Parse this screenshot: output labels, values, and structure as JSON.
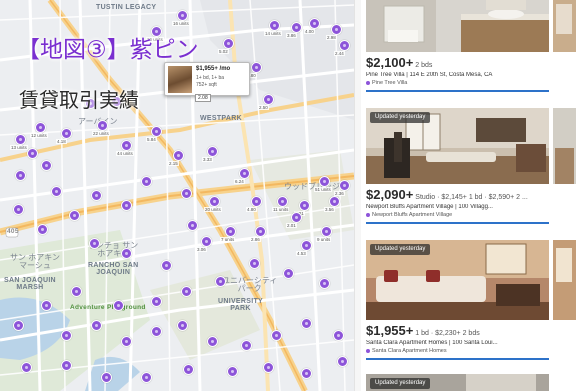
{
  "overlay": {
    "title": "【地図③】紫ピン",
    "subtitle": "賃貸取引実績"
  },
  "map": {
    "places": [
      {
        "key": "tustin_legacy",
        "label": "TUSTIN LEGACY",
        "cls": ""
      },
      {
        "key": "westpark",
        "label": "WESTPARK",
        "cls": ""
      },
      {
        "key": "rancho_san_joaquin",
        "label": "RANCHO SAN\nJOAQUIN",
        "cls": ""
      },
      {
        "key": "san_joaquin_marsh",
        "label": "SAN JOAQUIN\nMARSH",
        "cls": ""
      },
      {
        "key": "university_park",
        "label": "UNIVERSITY\nPARK",
        "cls": ""
      },
      {
        "key": "adventure_playground",
        "label": "Adventure Playground",
        "cls": "green"
      },
      {
        "key": "jp_irvine",
        "label": "アーバイン",
        "cls": "jp"
      },
      {
        "key": "jp_rancho",
        "label": "ランチョ サン\nホアキン",
        "cls": "jp"
      },
      {
        "key": "jp_university",
        "label": "ユニバーシティ\nパーク",
        "cls": "jp"
      },
      {
        "key": "jp_marsh",
        "label": "サン ホアキン\nマーシュ",
        "cls": "jp"
      },
      {
        "key": "jp_woodbridge",
        "label": "ウッドブリッジ",
        "cls": "jp"
      },
      {
        "key": "route_405",
        "label": "405",
        "cls": "road"
      }
    ],
    "pin_labels": [
      "14 units",
      "3.86",
      "4.00",
      "2.98",
      "16 units",
      "5.02",
      "2.44",
      "36 units",
      "1.80",
      "2.50",
      "12 units",
      "13 units",
      "4.18",
      "22 units",
      "44 units",
      "5.84",
      "2.15",
      "3.33",
      "6.24",
      "20 units",
      "4.80",
      "11 units",
      "2.01",
      "3.56",
      "51 units",
      "2.36",
      "2.01",
      "9 units",
      "4.53",
      "2.86",
      "7 units",
      "3.06"
    ],
    "popup": {
      "price": "$1,955+ /mo",
      "line1": "1+ bd, 1+ ba",
      "line2": "752+ sqft",
      "badge": "2.08"
    }
  },
  "listings": [
    {
      "updated": "",
      "price": "$2,100+",
      "detail": " 2 bds",
      "address": "Pine Tree Villa | 114 E 20th St, Costa Mesa, CA",
      "community": "Pine Tree Villa"
    },
    {
      "updated": "Updated yesterday",
      "price": "$2,090+",
      "detail": " Studio · $2,145+ 1 bd · $2,590+ 2 ...",
      "address": "Newport Bluffs Apartment Village | 100 Villagg...",
      "community": "Newport Bluffs Apartment Village"
    },
    {
      "updated": "Updated yesterday",
      "price": "$1,955+",
      "detail": " 1 bd · $2,230+ 2 bds",
      "address": "Santa Clara Apartment Homes | 100 Santa Loui...",
      "community": "Santa Clara Apartment Homes"
    },
    {
      "updated": "Updated yesterday",
      "price": "",
      "detail": "",
      "address": "",
      "community": ""
    }
  ],
  "colors": {
    "pin": "#8d54d9",
    "title": "#7a2fd0",
    "accent_rule": "#2d72c9"
  },
  "icons": {
    "pin": "map-pin-icon",
    "community": "community-dot-icon"
  }
}
